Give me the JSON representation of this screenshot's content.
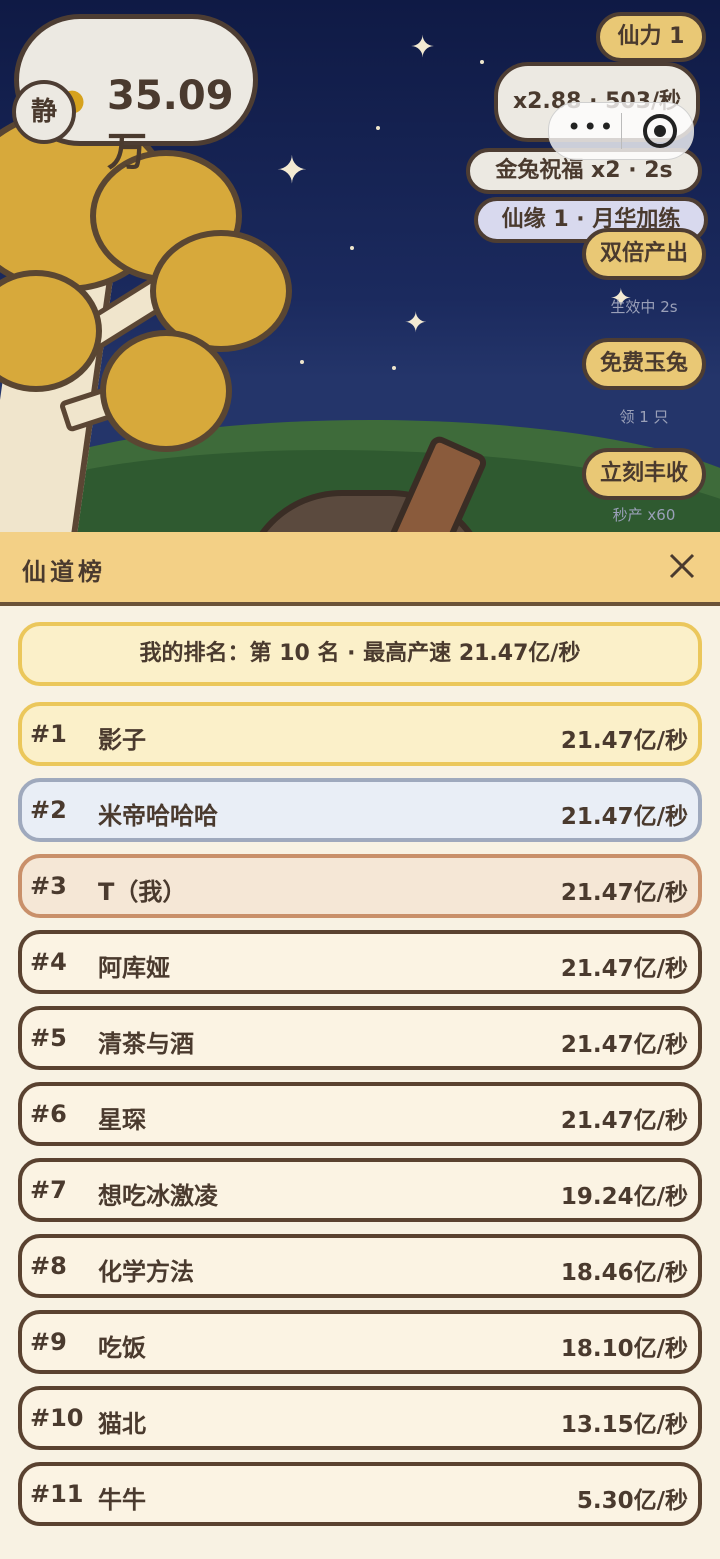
{
  "hud": {
    "coins": "35.09万",
    "quiet_label": "静",
    "fairy_power": "仙力 1",
    "multiplier": "x2.88 · 503/秒",
    "rabbit_blessing": "金兔祝福 x2 · 2s",
    "fate": "仙缘 1 · 月华加练"
  },
  "side_buttons": [
    {
      "label": "双倍产出",
      "sub": "生效中 2s"
    },
    {
      "label": "免费玉兔",
      "sub": "领 1 只"
    },
    {
      "label": "立刻丰收",
      "sub": "秒产 x60"
    }
  ],
  "panel": {
    "title": "仙道榜",
    "my_rank": "我的排名：第 10 名 · 最高产速 21.47亿/秒"
  },
  "rows": [
    {
      "rank": "#1",
      "name": "影子",
      "speed": "21.47亿/秒"
    },
    {
      "rank": "#2",
      "name": "米帝哈哈哈",
      "speed": "21.47亿/秒"
    },
    {
      "rank": "#3",
      "name": "T（我）",
      "speed": "21.47亿/秒"
    },
    {
      "rank": "#4",
      "name": "阿库娅",
      "speed": "21.47亿/秒"
    },
    {
      "rank": "#5",
      "name": "清茶与酒",
      "speed": "21.47亿/秒"
    },
    {
      "rank": "#6",
      "name": "星琛",
      "speed": "21.47亿/秒"
    },
    {
      "rank": "#7",
      "name": "想吃冰激凌",
      "speed": "19.24亿/秒"
    },
    {
      "rank": "#8",
      "name": "化学方法",
      "speed": "18.46亿/秒"
    },
    {
      "rank": "#9",
      "name": "吃饭",
      "speed": "18.10亿/秒"
    },
    {
      "rank": "#10",
      "name": "猫北",
      "speed": "13.15亿/秒"
    },
    {
      "rank": "#11",
      "name": "牛牛",
      "speed": "5.30亿/秒"
    }
  ],
  "colors": {
    "gold": "#ebc75b",
    "silver": "#9fa9bd",
    "bronze": "#c9906a",
    "panel_head": "#f3d086"
  }
}
